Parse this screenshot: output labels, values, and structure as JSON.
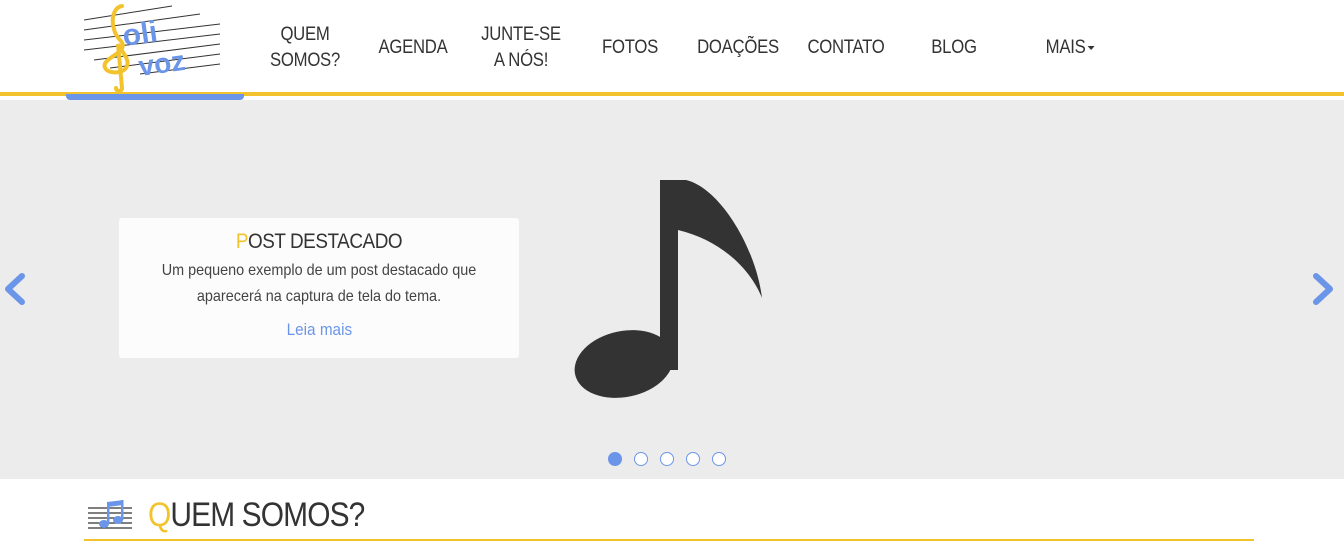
{
  "header": {
    "logo_alt": "Poli Voz logo",
    "nav": [
      {
        "label_line1": "QUEM",
        "label_line2": "SOMOS?"
      },
      {
        "label_line1": "AGENDA",
        "label_line2": ""
      },
      {
        "label_line1": "JUNTE-SE",
        "label_line2": "A NÓS!"
      },
      {
        "label_line1": "FOTOS",
        "label_line2": ""
      },
      {
        "label_line1": "DOAÇÕES",
        "label_line2": ""
      },
      {
        "label_line1": "CONTATO",
        "label_line2": ""
      },
      {
        "label_line1": "BLOG",
        "label_line2": ""
      },
      {
        "label_line1": "MAIS",
        "label_line2": ""
      }
    ]
  },
  "carousel": {
    "caption": {
      "title_first": "P",
      "title_rest": "OST DESTACADO",
      "text": "Um pequeno exemplo de um post destacado que aparecerá na captura de tela do tema.",
      "link": "Leia mais"
    },
    "slide_count": 5,
    "active_slide": 1,
    "image_icon": "music-note-icon"
  },
  "section": {
    "title_first": "Q",
    "title_rest": "UEM SOMOS?",
    "icon": "music-staff-icon"
  },
  "colors": {
    "accent_yellow": "#f3c32d",
    "accent_blue": "#6b95e8",
    "carousel_bg": "#ececec",
    "note_dark": "#333333"
  }
}
